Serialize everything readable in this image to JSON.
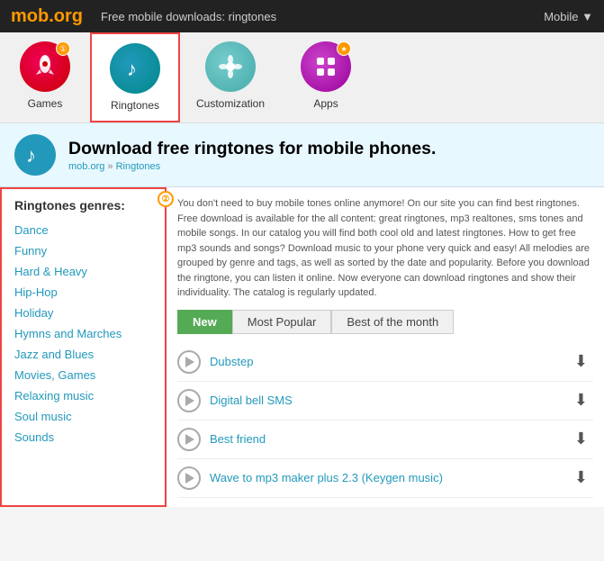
{
  "header": {
    "logo_text": "mob",
    "logo_accent": ".org",
    "title": "Free mobile downloads: ringtones",
    "right_text": "Mobile ▼"
  },
  "nav": {
    "items": [
      {
        "id": "games",
        "label": "Games",
        "icon_type": "games",
        "badge": "①"
      },
      {
        "id": "ringtones",
        "label": "Ringtones",
        "icon_type": "ringtones",
        "active": true
      },
      {
        "id": "customization",
        "label": "Customization",
        "icon_type": "custom"
      },
      {
        "id": "apps",
        "label": "Apps",
        "icon_type": "apps",
        "badge": "★"
      }
    ]
  },
  "banner": {
    "heading": "Download free ringtones for mobile phones.",
    "breadcrumb_root": "mob.org",
    "breadcrumb_section": "Ringtones"
  },
  "sidebar": {
    "title": "Ringtones genres:",
    "items": [
      "Dance",
      "Funny",
      "Hard & Heavy",
      "Hip-Hop",
      "Holiday",
      "Hymns and Marches",
      "Jazz and Blues",
      "Movies, Games",
      "Relaxing music",
      "Soul music",
      "Sounds"
    ]
  },
  "content": {
    "info": "You don't need to buy mobile tones online anymore! On our site you can find best ringtones. Free download is available for the all content: great ringtones, mp3 realtones, sms tones and mobile songs. In our catalog you will find both cool old and latest ringtones. How to get free mp3 sounds and songs? Download music to your phone very quick and easy! All melodies are grouped by genre and tags, as well as sorted by the date and popularity. Before you download the ringtone, you can listen it online. Now everyone can download ringtones and show their individuality. The catalog is regularly updated.",
    "tabs": [
      {
        "id": "new",
        "label": "New",
        "active": true
      },
      {
        "id": "popular",
        "label": "Most Popular",
        "active": false
      },
      {
        "id": "month",
        "label": "Best of the month",
        "active": false
      }
    ],
    "songs": [
      {
        "name": "Dubstep"
      },
      {
        "name": "Digital bell SMS"
      },
      {
        "name": "Best friend"
      },
      {
        "name": "Wave to mp3 maker plus 2.3 (Keygen music)"
      }
    ]
  }
}
